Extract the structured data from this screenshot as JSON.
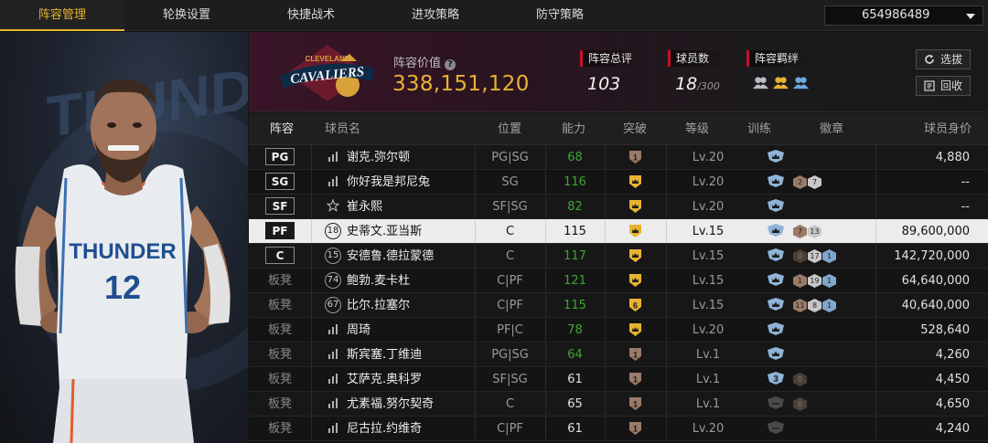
{
  "tabs": [
    "阵容管理",
    "轮换设置",
    "快捷战术",
    "进攻策略",
    "防守策略"
  ],
  "active_tab": 0,
  "account": {
    "value": "654986489"
  },
  "summary": {
    "value_label": "阵容价值",
    "value": "338,151,120",
    "rating_label": "阵容总评",
    "rating": "103",
    "players_label": "球员数",
    "players": "18",
    "players_max": "/300",
    "chem_label": "阵容羁绊",
    "btn_select": "选拔",
    "btn_recycle": "回收"
  },
  "columns": [
    "阵容",
    "球员名",
    "位置",
    "能力",
    "突破",
    "等级",
    "训练",
    "徽章",
    "球员身价"
  ],
  "colors": {
    "accent": "#e8b331",
    "green": "#3fa535",
    "red": "#c8102e"
  },
  "rows": [
    {
      "pos": "PG",
      "is_starter": true,
      "num_icon": "signal",
      "num": "",
      "name": "谢克.弥尔顿",
      "positions": "PG|SG",
      "ability": "68",
      "ability_color": "green",
      "break_icon": "1",
      "level": "Lv.20",
      "train": "crown",
      "badges": [],
      "value": "4,880",
      "selected": false
    },
    {
      "pos": "SG",
      "is_starter": true,
      "num_icon": "signal",
      "num": "",
      "name": "你好我是邦尼兔",
      "positions": "SG",
      "ability": "116",
      "ability_color": "green",
      "break_icon": "crown",
      "level": "Lv.20",
      "train": "crown",
      "badges": [
        {
          "t": "bronze",
          "v": "2"
        },
        {
          "t": "silver",
          "v": "7"
        }
      ],
      "value": "--",
      "selected": false
    },
    {
      "pos": "SF",
      "is_starter": true,
      "num_icon": "star",
      "num": "",
      "name": "崔永熙",
      "positions": "SF|SG",
      "ability": "82",
      "ability_color": "green",
      "break_icon": "crown",
      "level": "Lv.20",
      "train": "crown",
      "badges": [],
      "value": "--",
      "selected": false
    },
    {
      "pos": "PF",
      "is_starter": true,
      "num_icon": "circle",
      "num": "18",
      "name": "史蒂文.亚当斯",
      "positions": "C",
      "ability": "115",
      "ability_color": "white",
      "break_icon": "crown",
      "level": "Lv.15",
      "train": "crown",
      "badges": [
        {
          "t": "bronze",
          "v": "7"
        },
        {
          "t": "silver",
          "v": "13"
        }
      ],
      "value": "89,600,000",
      "selected": true
    },
    {
      "pos": "C",
      "is_starter": true,
      "num_icon": "circle",
      "num": "15",
      "name": "安德鲁.德拉蒙德",
      "positions": "C",
      "ability": "117",
      "ability_color": "green",
      "break_icon": "crown",
      "level": "Lv.15",
      "train": "crown",
      "badges": [
        {
          "t": "dark",
          "v": "0"
        },
        {
          "t": "silver",
          "v": "17"
        },
        {
          "t": "blue",
          "v": "1"
        }
      ],
      "value": "142,720,000",
      "selected": false
    },
    {
      "pos": "板凳",
      "is_starter": false,
      "num_icon": "circle",
      "num": "74",
      "name": "鲍勃.麦卡杜",
      "positions": "C|PF",
      "ability": "121",
      "ability_color": "green",
      "break_icon": "crown",
      "level": "Lv.15",
      "train": "crown",
      "badges": [
        {
          "t": "bronze",
          "v": "1"
        },
        {
          "t": "silver",
          "v": "19"
        },
        {
          "t": "blue",
          "v": "1"
        }
      ],
      "value": "64,640,000",
      "selected": false
    },
    {
      "pos": "板凳",
      "is_starter": false,
      "num_icon": "circle",
      "num": "67",
      "name": "比尔.拉塞尔",
      "positions": "C|PF",
      "ability": "115",
      "ability_color": "green",
      "break_icon": "6",
      "level": "Lv.15",
      "train": "crown",
      "badges": [
        {
          "t": "bronze",
          "v": "11"
        },
        {
          "t": "silver",
          "v": "8"
        },
        {
          "t": "blue",
          "v": "1"
        }
      ],
      "value": "40,640,000",
      "selected": false
    },
    {
      "pos": "板凳",
      "is_starter": false,
      "num_icon": "signal",
      "num": "",
      "name": "周琦",
      "positions": "PF|C",
      "ability": "78",
      "ability_color": "green",
      "break_icon": "crown",
      "level": "Lv.20",
      "train": "crown",
      "badges": [],
      "value": "528,640",
      "selected": false
    },
    {
      "pos": "板凳",
      "is_starter": false,
      "num_icon": "signal",
      "num": "",
      "name": "斯宾塞.丁维迪",
      "positions": "PG|SG",
      "ability": "64",
      "ability_color": "green",
      "break_icon": "1",
      "level": "Lv.1",
      "train": "crown",
      "badges": [],
      "value": "4,260",
      "selected": false
    },
    {
      "pos": "板凳",
      "is_starter": false,
      "num_icon": "signal",
      "num": "",
      "name": "艾萨克.奥科罗",
      "positions": "SF|SG",
      "ability": "61",
      "ability_color": "white",
      "break_icon": "1",
      "level": "Lv.1",
      "train": "3",
      "badges": [
        {
          "t": "dark",
          "v": "0"
        }
      ],
      "value": "4,450",
      "selected": false
    },
    {
      "pos": "板凳",
      "is_starter": false,
      "num_icon": "signal",
      "num": "",
      "name": "尤素福.努尔契奇",
      "positions": "C",
      "ability": "65",
      "ability_color": "white",
      "break_icon": "1",
      "level": "Lv.1",
      "train": "dim",
      "badges": [
        {
          "t": "dark",
          "v": "0"
        }
      ],
      "value": "4,650",
      "selected": false
    },
    {
      "pos": "板凳",
      "is_starter": false,
      "num_icon": "signal",
      "num": "",
      "name": "尼古拉.约维奇",
      "positions": "C|PF",
      "ability": "61",
      "ability_color": "white",
      "break_icon": "1",
      "level": "Lv.20",
      "train": "dim",
      "badges": [],
      "value": "4,240",
      "selected": false
    }
  ],
  "art": {
    "team_word": "THUNDER",
    "jersey_number": "12",
    "bg_word": "THUNDER",
    "logo_text": "CLEVELAND",
    "logo_word": "CAVALIERS"
  }
}
